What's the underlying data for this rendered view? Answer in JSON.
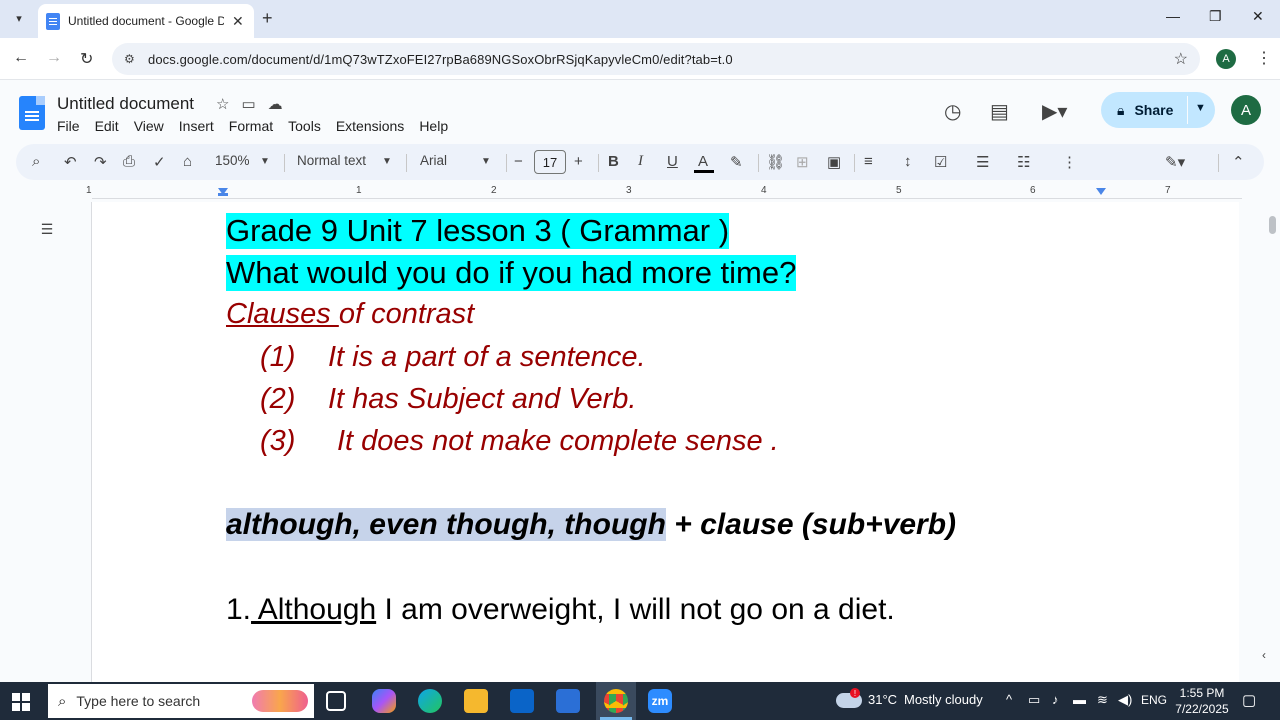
{
  "browser": {
    "tab_title": "Untitled document - Google Docs",
    "new_tab": "+",
    "url": "docs.google.com/document/d/1mQ73wTZxoFEI27rpBa689NGSoxObrRSjqKapyvleCm0/edit?tab=t.0",
    "profile_initial": "A"
  },
  "docs": {
    "title": "Untitled document",
    "menu": [
      "File",
      "Edit",
      "View",
      "Insert",
      "Format",
      "Tools",
      "Extensions",
      "Help"
    ],
    "share_label": "Share",
    "avatar_initial": "A"
  },
  "toolbar": {
    "zoom": "150%",
    "style": "Normal text",
    "font": "Arial",
    "font_size": "17",
    "bold": "B",
    "italic": "I",
    "underline": "U",
    "text_color": "A"
  },
  "ruler": {
    "numbers": [
      "1",
      "1",
      "2",
      "3",
      "4",
      "5",
      "6",
      "7"
    ]
  },
  "document": {
    "heading1": "Grade 9 Unit 7 lesson 3 ( Grammar )",
    "heading2": "What would you do if you had more time?",
    "clauses_word": "Clauses ",
    "clauses_rest": "of contrast",
    "points": [
      {
        "num": "(1)",
        "text": "It is a part of a sentence."
      },
      {
        "num": "(2)",
        "text": "It has Subject and Verb."
      },
      {
        "num": "(3)",
        "text": "It does not make complete sense ."
      }
    ],
    "conj_selected": "although, even though, though",
    "conj_rest": " + clause (sub+verb)",
    "example1_num": "1.",
    "example1_word": " Although",
    "example1_rest": " I am overweight, I will not go on a diet."
  },
  "taskbar": {
    "search_placeholder": "Type here to search",
    "temperature": "31°C",
    "weather": "Mostly cloudy",
    "language": "ENG",
    "time": "1:55 PM",
    "date": "7/22/2025",
    "zoom_app": "zm"
  },
  "colors": {
    "highlight": "#00ffff",
    "dark_red": "#980000",
    "selection": "#c6d3ea",
    "share_bg": "#c2e7ff",
    "toolbar_bg": "#edf2fa",
    "taskbar_bg": "#1f2b3a"
  }
}
